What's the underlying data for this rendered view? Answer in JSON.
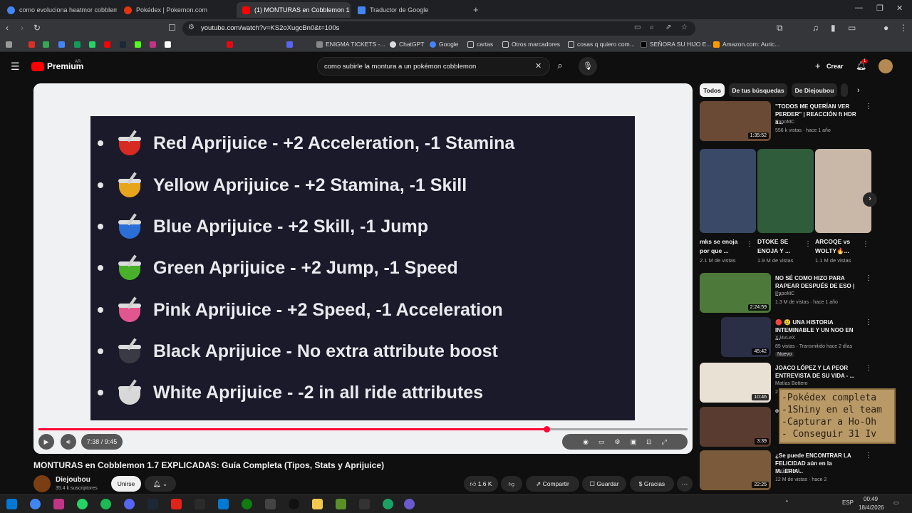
{
  "browser": {
    "tabs": [
      {
        "title": "como evoluciona heatmor cobblemo",
        "color": "#4285f4"
      },
      {
        "title": "Pokédex | Pokemon.com",
        "color": "#e3350d"
      },
      {
        "title": "(1) MONTURAS en Cobblemon 1",
        "color": "#ff0000"
      },
      {
        "title": "Traductor de Google",
        "color": "#4285f4"
      }
    ],
    "url": "youtube.com/watch?v=KS2oXugcBn0&t=100s",
    "bookmarks": [
      {
        "label": "ENIGMA TICKETS -...",
        "color": "#888888"
      },
      {
        "label": "ChatGPT",
        "color": "#dddddd"
      },
      {
        "label": "Google",
        "color": "#4285f4"
      },
      {
        "label": "cartas",
        "color": "#cccccc"
      },
      {
        "label": "Otros marcadores",
        "color": "#cccccc"
      },
      {
        "label": "cosas q quiero com...",
        "color": "#cccccc"
      },
      {
        "label": "SEÑORA SU HIJO E...",
        "color": "#000000"
      },
      {
        "label": "Amazon.com: Auric...",
        "color": "#ff9900"
      }
    ]
  },
  "youtube": {
    "brand": "Premium",
    "region": "AR",
    "search_query": "como subirle la montura a un pokémon cobblemon",
    "create_label": "Crear",
    "notif_count": "1"
  },
  "slide": {
    "items": [
      {
        "text": "Red Aprijuice - +2 Acceleration, -1 Stamina",
        "color": "#d62a22"
      },
      {
        "text": "Yellow Aprijuice - +2 Stamina, -1 Skill",
        "color": "#e6a51c"
      },
      {
        "text": "Blue Aprijuice - +2 Skill, -1 Jump",
        "color": "#2b6fd6"
      },
      {
        "text": "Green Aprijuice - +2 Jump, -1 Speed",
        "color": "#49b02a"
      },
      {
        "text": "Pink Aprijuice - +2 Speed, -1 Acceleration",
        "color": "#e2568f"
      },
      {
        "text": "Black Aprijuice - No extra attribute boost",
        "color": "#3a3a44"
      },
      {
        "text": "White Aprijuice - -2 in all ride attributes",
        "color": "#d8d8d8"
      }
    ]
  },
  "player": {
    "time": "7:38 / 9:45",
    "progress": 0.783
  },
  "video": {
    "title": "MONTURAS en Cobblemon 1.7 EXPLICADAS: Guía Completa (Tipos, Stats y Aprijuice)",
    "channel": "Diejoubou",
    "subs": "35.4 k suscriptores",
    "join": "Unirse",
    "likes": "1.6 K",
    "share": "Compartir",
    "save": "Guardar",
    "thanks": "Gracias"
  },
  "chips": [
    "Todos",
    "De tus búsquedas",
    "De Diejoubou"
  ],
  "recs": [
    {
      "title": "\"TODOS ME QUERÍAN VER PERDER\" | REACCIÓN ft HDR a...",
      "channel": "PapoMC",
      "meta": "556 k vistas · hace 1 año",
      "dur": "1:35:52",
      "color": "#6b4a35"
    }
  ],
  "shorts": [
    {
      "title": "mks se enoja por que ...",
      "views": "2.1 M de vistas",
      "color": "#3a4a66"
    },
    {
      "title": "DTOKE SE ENOJA Y ...",
      "views": "1.9 M de vistas",
      "color": "#2f5c3a"
    },
    {
      "title": "ARCOQE vs WOLTY🔥...",
      "views": "1.1 M de vistas",
      "color": "#c9b8a8"
    }
  ],
  "recs2": [
    {
      "title": "NO SÉ COMO HIZO PARA RAPEAR DESPUÉS DE ESO | ...",
      "channel": "PapoMC",
      "meta": "1.3 M de vistas · hace 1 año",
      "dur": "2:24:59",
      "color": "#4d7a3a"
    },
    {
      "title": "🔴 😢 UNA HISTORIA INTEMINABLE Y UN NOO EN ...",
      "channel": "XJ4vLeX",
      "meta": "85 vistas · Transmitido hace 2 días",
      "badge": "Nuevo",
      "dur": "45:42",
      "color": "#2b2f45"
    },
    {
      "title": "JOACO LÓPEZ Y LA PEOR ENTREVISTA DE SU VIDA - ...",
      "channel": "Matías Bottero",
      "meta": "2",
      "dur": "10:46",
      "color": "#e8e1d4"
    },
    {
      "title": "o",
      "channel": "",
      "meta": "",
      "dur": "3:39",
      "color": "#5a3b30"
    },
    {
      "title": "¿Se puede ENCONTRAR LA FELICIDAD aún en la M...ERIA...",
      "channel": "Farid Dieck",
      "meta": "12 M de vistas · hace 2",
      "dur": "22:25",
      "color": "#7a5a3a"
    }
  ],
  "mc_note": [
    "-Pokédex completa",
    "-1Shiny en el team",
    "-Capturar a Ho-Oh",
    "- Conseguir 31 Iv"
  ],
  "taskbar": {
    "lang": "ESP",
    "time": "00:49",
    "date": "18/4/2026"
  }
}
